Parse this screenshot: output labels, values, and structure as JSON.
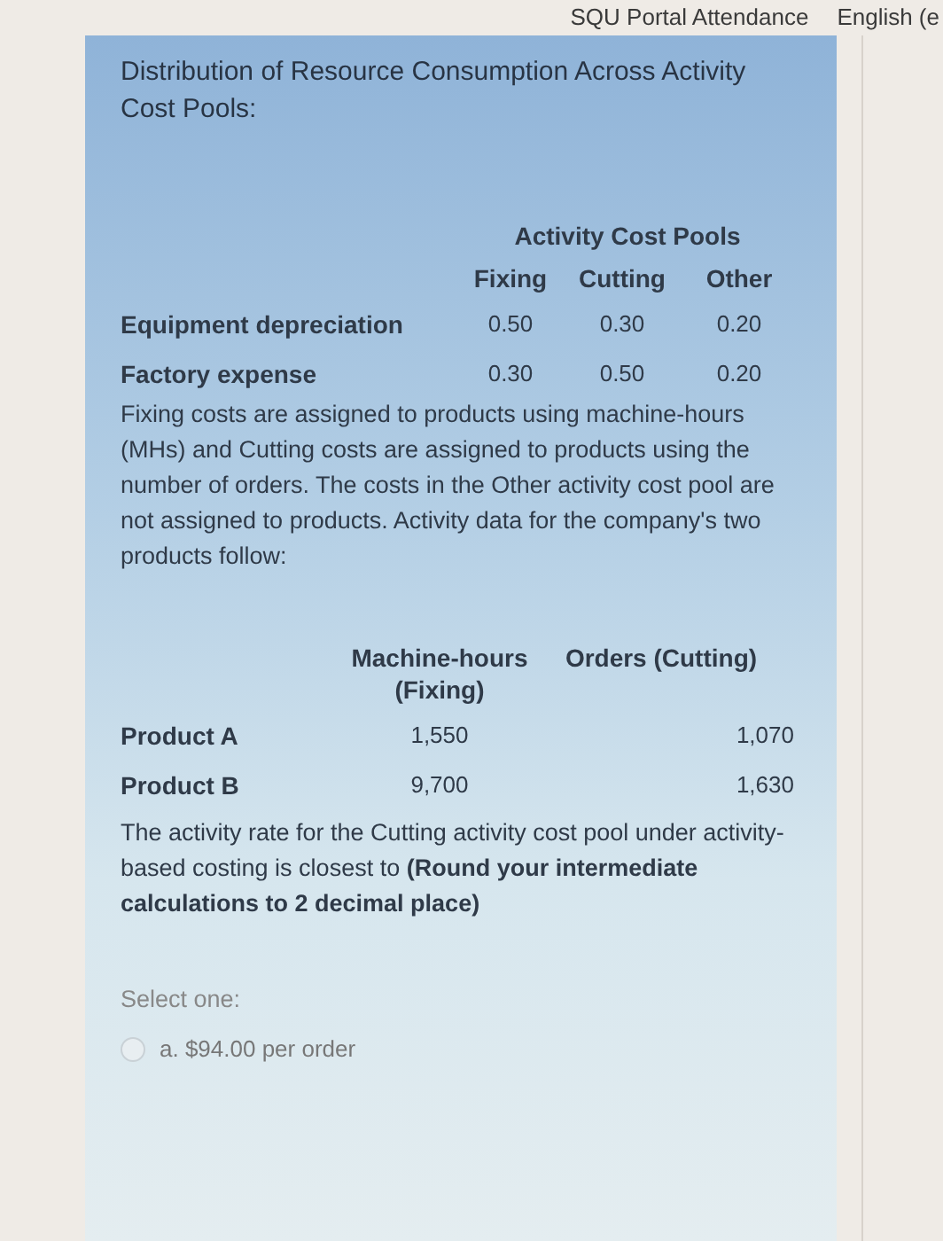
{
  "nav": {
    "items": [
      "SQU Portal Attendance",
      "English (e"
    ]
  },
  "question": {
    "intro": "Distribution of Resource Consumption Across Activity Cost Pools:",
    "pools_table": {
      "group_heading": "Activity Cost Pools",
      "columns": [
        "Fixing",
        "Cutting",
        "Other"
      ],
      "rows": [
        {
          "label": "Equipment depreciation",
          "values": [
            "0.50",
            "0.30",
            "0.20"
          ]
        },
        {
          "label": "Factory expense",
          "values": [
            "0.30",
            "0.50",
            "0.20"
          ]
        }
      ]
    },
    "explanation": "Fixing costs are assigned to products using machine-hours (MHs) and Cutting costs are assigned to products using the number of orders. The costs in the Other activity cost pool are not assigned to products. Activity data for the company's two products follow:",
    "activity_table": {
      "columns": [
        "Machine-hours (Fixing)",
        "Orders (Cutting)"
      ],
      "rows": [
        {
          "label": "Product A",
          "values": [
            "1,550",
            "1,070"
          ]
        },
        {
          "label": "Product B",
          "values": [
            "9,700",
            "1,630"
          ]
        }
      ]
    },
    "prompt": "The activity rate for the Cutting activity cost pool under activity-based costing is closest to **(Round your intermediate calculations to 2 decimal place)**",
    "select_label": "Select one:",
    "options": [
      {
        "label": "a. $94.00 per order",
        "selected": false
      }
    ]
  }
}
